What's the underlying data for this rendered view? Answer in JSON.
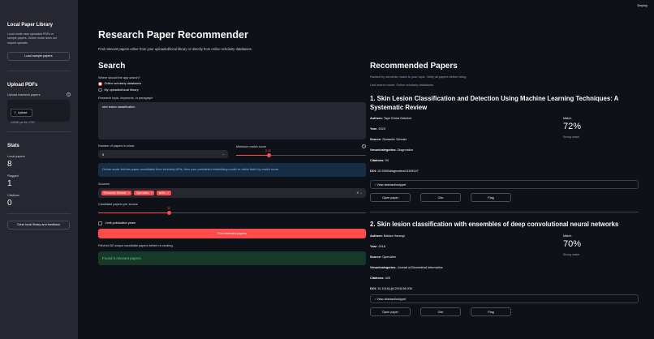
{
  "header": {
    "deploy_label": "Deploy",
    "title": "Research Paper Recommender",
    "subtitle": "Find relevant papers either from your uploaded/local library or directly from online scholarly databases."
  },
  "sidebar": {
    "library_heading": "Local Paper Library",
    "library_desc_1": "Local mode uses uploaded PDFs or",
    "library_desc_2": "sample papers. Online mode does not",
    "library_desc_3": "require uploads.",
    "load_sample_label": "Load sample papers",
    "upload_heading": "Upload PDFs",
    "upload_label": "Upload research papers",
    "upload_button_label": "Upload",
    "upload_limit": "100MB per file • PDF",
    "stats_heading": "Stats",
    "stats": [
      {
        "label": "Local papers",
        "value": "8"
      },
      {
        "label": "Flagged",
        "value": "1"
      },
      {
        "label": "Citations",
        "value": "0"
      }
    ],
    "clear_label": "Clear local library and feedback"
  },
  "search": {
    "heading": "Search",
    "where_label": "Where should the app search?",
    "options": [
      "Online scholarly databases",
      "My uploaded/local library"
    ],
    "selected_option": 0,
    "topic_label": "Research topic, keywords, or paragraph",
    "topic_value": "skin lesion classification",
    "num_label": "Number of papers to show",
    "num_value": "5",
    "min_match_label": "Minimum match score",
    "min_match_value": "0.25",
    "min_match_fraction": 0.25,
    "info_text": "Online mode fetches paper candidates from scholarly APIs, then your pretrained embedding model re-ranks them by match score.",
    "sources_label": "Sources",
    "sources": [
      "Semantic Scholar",
      "OpenAlex",
      "arXiv"
    ],
    "candidate_label": "Candidate papers per source",
    "candidate_value": "30",
    "candidate_fraction": 0.2,
    "limit_years_label": "Limit publication years",
    "find_label": "Find relevant papers",
    "fetched_text": "Fetched 82 unique candidate papers before re-ranking.",
    "success_text": "Found 5 relevant papers."
  },
  "recommended": {
    "heading": "Recommended Papers",
    "note_1": "Ranked by semantic match to your topic. Verify all papers before citing.",
    "note_2": "Last search mode: Online scholarly databases",
    "papers": [
      {
        "title": "1. Skin Lesion Classification and Detection Using Machine Learning Techniques: A Systematic Review",
        "authors": "Taye Girma Debelee",
        "year": "2023",
        "source": "Semantic Scholar",
        "venue": "Diagnostics",
        "citations": "93",
        "doi": "10.3390/diagnostics13193147",
        "match": "72%",
        "match_desc": "Strong match"
      },
      {
        "title": "2. Skin lesion classification with ensembles of deep convolutional neural networks",
        "authors": "Balázs Harangi",
        "year": "2018",
        "source": "OpenAlex",
        "venue": "Journal of Biomedical Informatics",
        "citations": "429",
        "doi": "10.1016/j.jbi.2018.08.006",
        "match": "70%",
        "match_desc": "Strong match"
      }
    ],
    "labels": {
      "authors": "Authors:",
      "year": "Year:",
      "source": "Source:",
      "venue": "Venue/categories:",
      "citations": "Citations:",
      "doi": "DOI:",
      "match": "Match",
      "expander": "View abstract/snippet",
      "open": "Open paper",
      "cite": "Cite",
      "flag": "Flag"
    }
  },
  "colors": {
    "accent": "#ff4b4b",
    "background": "#0e1117",
    "sidebar": "#262730",
    "info_bg": "#172d43",
    "success_bg": "#173928"
  },
  "icons": {
    "upload": "upload-icon",
    "help": "help-icon",
    "chevron": "chevron-down-icon",
    "expand": "chevron-right-icon"
  }
}
